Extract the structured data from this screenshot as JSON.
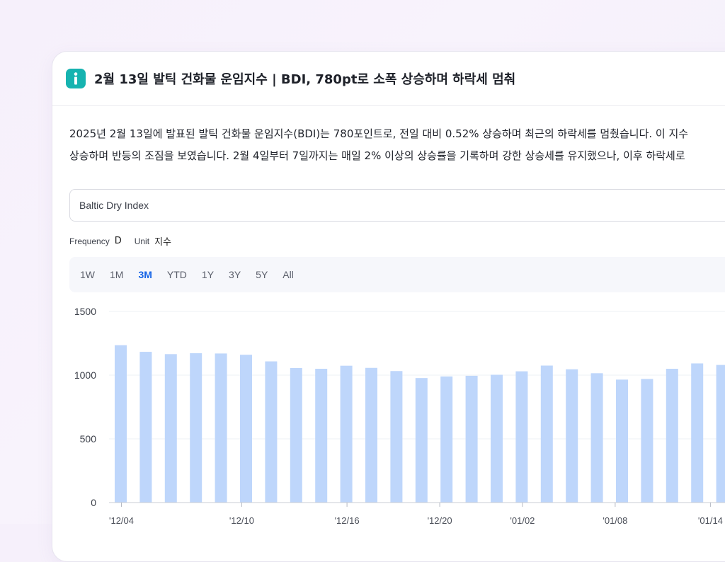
{
  "card": {
    "title": "2월 13일 발틱 건화물 운임지수 | BDI, 780pt로 소폭 상승하며 하락세 멈춰",
    "description_lines": [
      "2025년 2월 13일에 발표된 발틱 건화물 운임지수(BDI)는 780포인트로, 전일 대비 0.52% 상승하며 최근의 하락세를 멈췄습니다. 이 지수",
      "상승하며 반등의 조짐을 보였습니다. 2월 4일부터 7일까지는 매일 2% 이상의 상승률을 기록하며 강한 상승세를 유지했으나, 이후 하락세로"
    ]
  },
  "series_input": {
    "value": "Baltic Dry Index"
  },
  "meta": {
    "frequency_label": "Frequency",
    "frequency_value": "D",
    "unit_label": "Unit",
    "unit_value": "지수"
  },
  "range_buttons": [
    "1W",
    "1M",
    "3M",
    "YTD",
    "1Y",
    "3Y",
    "5Y",
    "All"
  ],
  "active_range": "3M",
  "colors": {
    "bar": "#bed6fb",
    "accent": "#1463e6",
    "info_icon": "#16b3b0"
  },
  "chart_data": {
    "type": "bar",
    "ylim": [
      0,
      1500
    ],
    "y_ticks": [
      0,
      500,
      1000,
      1500
    ],
    "x_tick_labels": [
      "'12/04",
      "'12/10",
      "'12/16",
      "'12/20",
      "'01/02",
      "'01/08",
      "'01/14"
    ],
    "values": [
      1235,
      1183,
      1165,
      1172,
      1170,
      1160,
      1108,
      1056,
      1050,
      1074,
      1057,
      1032,
      977,
      990,
      995,
      1003,
      1030,
      1075,
      1046,
      1015,
      965,
      970,
      1050,
      1092,
      1080
    ],
    "grid": true
  }
}
